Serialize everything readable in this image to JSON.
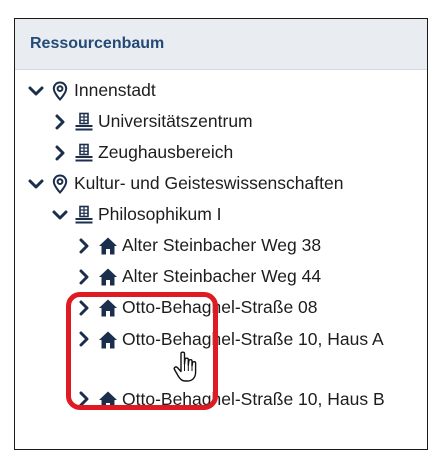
{
  "panel": {
    "title": "Ressourcenbaum"
  },
  "tree": [
    {
      "label": "Innenstadt",
      "level": 0,
      "icon": "location-pin-icon",
      "expanded": true
    },
    {
      "label": "Universitätszentrum",
      "level": 1,
      "icon": "building-icon",
      "expanded": false
    },
    {
      "label": "Zeughausbereich",
      "level": 1,
      "icon": "building-icon",
      "expanded": false
    },
    {
      "label": "Kultur- und Geisteswissenschaften",
      "level": 0,
      "icon": "location-pin-icon",
      "expanded": true
    },
    {
      "label": "Philosophikum I",
      "level": 1,
      "icon": "building-icon",
      "expanded": true
    },
    {
      "label": "Alter Steinbacher Weg 38",
      "level": 2,
      "icon": "house-icon",
      "expanded": false
    },
    {
      "label": "Alter Steinbacher Weg 44",
      "level": 2,
      "icon": "house-icon",
      "expanded": false
    },
    {
      "label": "Otto-Behaghel-Straße 08",
      "level": 2,
      "icon": "house-icon",
      "expanded": false
    },
    {
      "label": "Otto-Behaghel-Straße 10, Haus A",
      "level": 2,
      "icon": "house-icon",
      "expanded": false
    },
    {
      "label": "Otto-Behaghel-Straße 10, Haus B",
      "level": 2,
      "icon": "house-icon",
      "expanded": false
    }
  ],
  "colors": {
    "header_bg": "#e9edf2",
    "header_text": "#244a78",
    "icon": "#1b2f4d",
    "highlight": "#e01a22"
  }
}
